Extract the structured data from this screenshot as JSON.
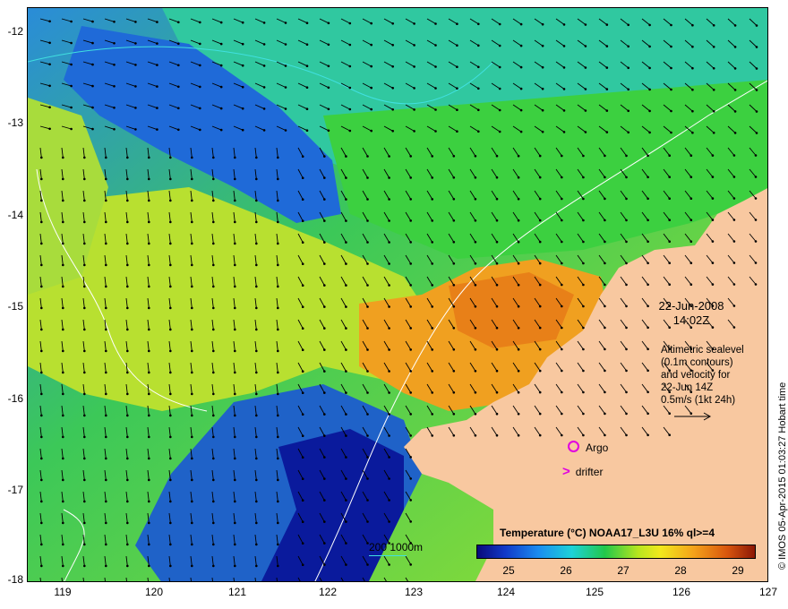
{
  "axes": {
    "lat_ticks": [
      "-12",
      "-13",
      "-14",
      "-15",
      "-16",
      "-17",
      "-18"
    ],
    "lon_ticks": [
      "119",
      "120",
      "121",
      "122",
      "123",
      "124",
      "125",
      "126",
      "127"
    ]
  },
  "annotation": {
    "date": "22-Jun-2008",
    "time": "14:02Z",
    "altimetry_lines": [
      "Altimetric sealevel",
      "(0.1m contours)",
      "and velocity for",
      "22-Jun 14Z",
      "0.5m/s (1kt 24h)"
    ]
  },
  "legend": {
    "argo": "Argo",
    "drifter": "drifter",
    "drifter_symbol": ">",
    "marker_color": "#e000e0",
    "contour_label": "200  1000m",
    "contour_color": "#40e0e0"
  },
  "colorbar": {
    "title": "Temperature (°C) NOAA17_L3U 16% ql>=4",
    "ticks": [
      "25",
      "26",
      "27",
      "28",
      "29"
    ],
    "range": [
      24.5,
      29.3
    ]
  },
  "credit": "© IMOS 05-Apr-2015 01:03:27 Hobart time",
  "colors": {
    "land": "#f8c8a0",
    "deep_blue": "#0a1a9c",
    "green": "#22c84a",
    "yellow": "#f2e81c",
    "orange": "#f0a020"
  }
}
